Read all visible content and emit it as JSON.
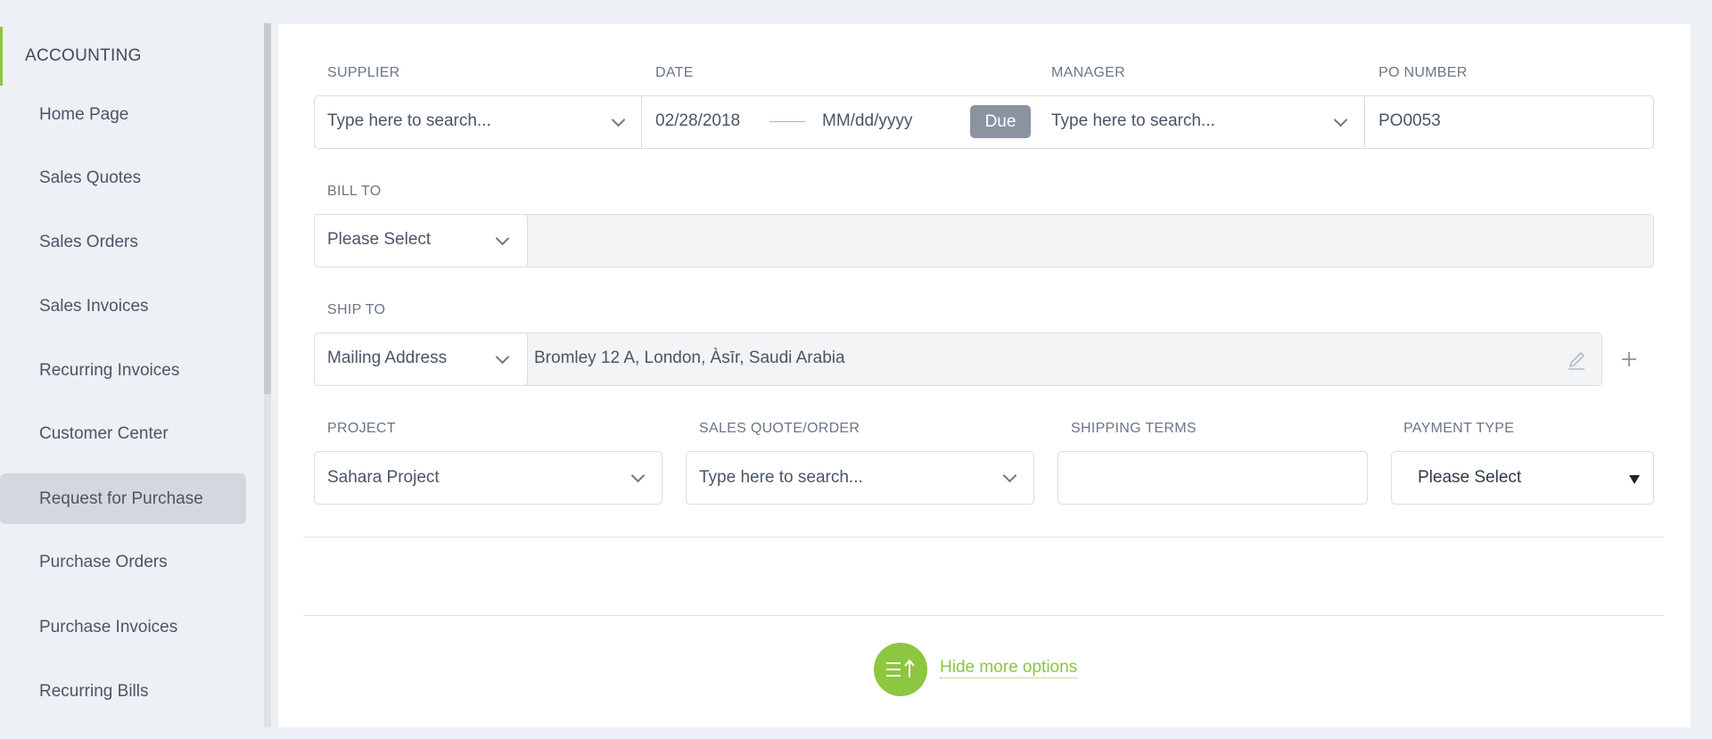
{
  "sidebar": {
    "section": "ACCOUNTING",
    "items": [
      {
        "label": "Home Page"
      },
      {
        "label": "Sales Quotes"
      },
      {
        "label": "Sales Orders"
      },
      {
        "label": "Sales Invoices"
      },
      {
        "label": "Recurring Invoices"
      },
      {
        "label": "Customer Center"
      },
      {
        "label": "Request for Purchase",
        "active": true
      },
      {
        "label": "Purchase Orders"
      },
      {
        "label": "Purchase Invoices"
      },
      {
        "label": "Recurring Bills"
      }
    ]
  },
  "form": {
    "supplier": {
      "label": "SUPPLIER",
      "placeholder": "Type here to search..."
    },
    "date": {
      "label": "DATE",
      "value": "02/28/2018",
      "due_placeholder": "MM/dd/yyyy",
      "due_badge": "Due"
    },
    "manager": {
      "label": "MANAGER",
      "placeholder": "Type here to search..."
    },
    "po_number": {
      "label": "PO NUMBER",
      "value": "PO0053"
    },
    "bill_to": {
      "label": "BILL TO",
      "select": "Please Select",
      "value": ""
    },
    "ship_to": {
      "label": "SHIP TO",
      "select": "Mailing Address",
      "value": "Bromley 12 A, London, Àsīr, Saudi Arabia"
    },
    "project": {
      "label": "PROJECT",
      "value": "Sahara Project"
    },
    "sales_quote_order": {
      "label": "SALES QUOTE/ORDER",
      "placeholder": "Type here to search..."
    },
    "shipping_terms": {
      "label": "SHIPPING TERMS",
      "value": ""
    },
    "payment_type": {
      "label": "PAYMENT TYPE",
      "value": "Please Select"
    }
  },
  "footer": {
    "toggle_label": "Hide more options"
  },
  "icons": {
    "chevron": "chevron-down-icon",
    "edit": "pencil-icon",
    "add": "plus-icon",
    "options": "collapse-options-icon"
  },
  "colors": {
    "accent": "#8dc63f",
    "badge": "#8a939f",
    "active_item": "#d4d8de"
  }
}
